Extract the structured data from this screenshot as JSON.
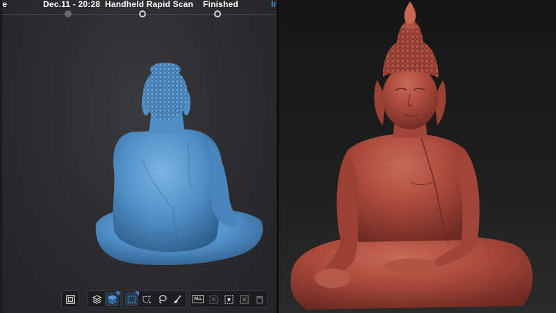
{
  "workflow": {
    "steps": [
      {
        "label": "ne",
        "state": "done"
      },
      {
        "label": "Dec.11 - 20:28",
        "state": "done"
      },
      {
        "label": "Handheld Rapid Scan",
        "state": "current"
      },
      {
        "label": "Finished",
        "state": "pending"
      }
    ],
    "overflow_label": "In"
  },
  "toolbar": {
    "groups": [
      {
        "name": "view",
        "tools": [
          {
            "icon": "box-view-icon",
            "active": false
          }
        ]
      },
      {
        "name": "layers",
        "tools": [
          {
            "icon": "layers-icon",
            "active": false
          },
          {
            "icon": "layers-active-icon",
            "active": true
          }
        ]
      },
      {
        "name": "selection",
        "tools": [
          {
            "icon": "rect-select-icon",
            "active": true
          },
          {
            "icon": "polygon-select-icon",
            "active": false
          },
          {
            "icon": "lasso-select-icon",
            "active": false
          },
          {
            "icon": "brush-select-icon",
            "active": false
          }
        ]
      },
      {
        "name": "edit",
        "tools": [
          {
            "icon": "select-all-icon",
            "label": "ALL",
            "active": false
          },
          {
            "icon": "invert-selection-icon",
            "active": false,
            "dim": true
          },
          {
            "icon": "deselect-icon",
            "active": false
          },
          {
            "icon": "delete-selection-icon",
            "active": false,
            "dim": true
          },
          {
            "icon": "trash-icon",
            "active": false,
            "dim": true
          }
        ]
      }
    ]
  },
  "colors": {
    "scan_model": "#4f8fc6",
    "render_model": "#a8483a",
    "accent": "#3f8fe6"
  },
  "right_panel": {
    "subject": "seated-buddha-render"
  }
}
